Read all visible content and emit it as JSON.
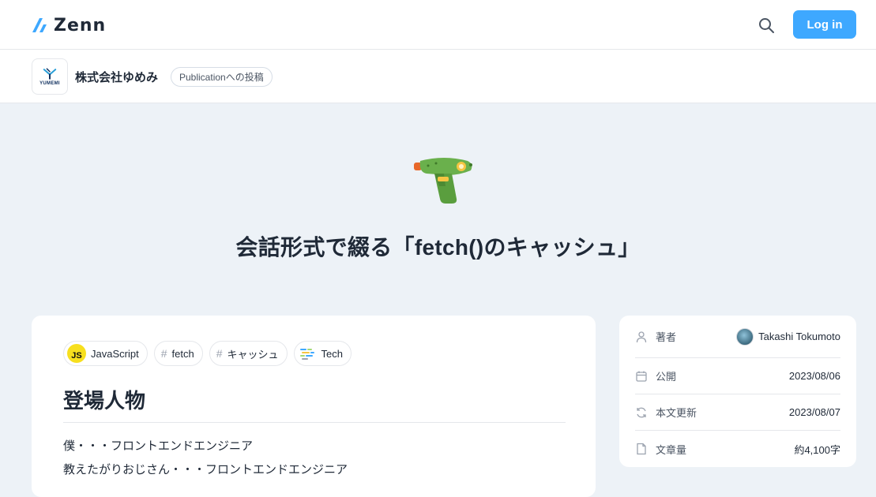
{
  "header": {
    "logo_text": "Zenn",
    "login_label": "Log in"
  },
  "publication": {
    "logo_text": "YUMEMI",
    "name": "株式会社ゆめみ",
    "badge": "Publicationへの投稿"
  },
  "article": {
    "emoji_icon": "water-pistol-icon",
    "title": "会話形式で綴る「fetch()のキャッシュ」",
    "tags": [
      {
        "label": "JavaScript",
        "icon": "javascript-icon"
      },
      {
        "label": "fetch",
        "icon": "hash-icon"
      },
      {
        "label": "キャッシュ",
        "icon": "hash-icon"
      },
      {
        "label": "Tech",
        "icon": "tech-icon"
      }
    ],
    "heading": "登場人物",
    "lines": [
      "僕・・・フロントエンドエンジニア",
      "教えたがりおじさん・・・フロントエンドエンジニア"
    ]
  },
  "meta": {
    "author_label": "著者",
    "author_name": "Takashi Tokumoto",
    "published_label": "公開",
    "published_date": "2023/08/06",
    "updated_label": "本文更新",
    "updated_date": "2023/08/07",
    "length_label": "文章量",
    "length_value": "約4,100字"
  },
  "colors": {
    "accent": "#3ea8ff",
    "hero_background": "#edf2f7",
    "js_yellow": "#f7df1e"
  }
}
